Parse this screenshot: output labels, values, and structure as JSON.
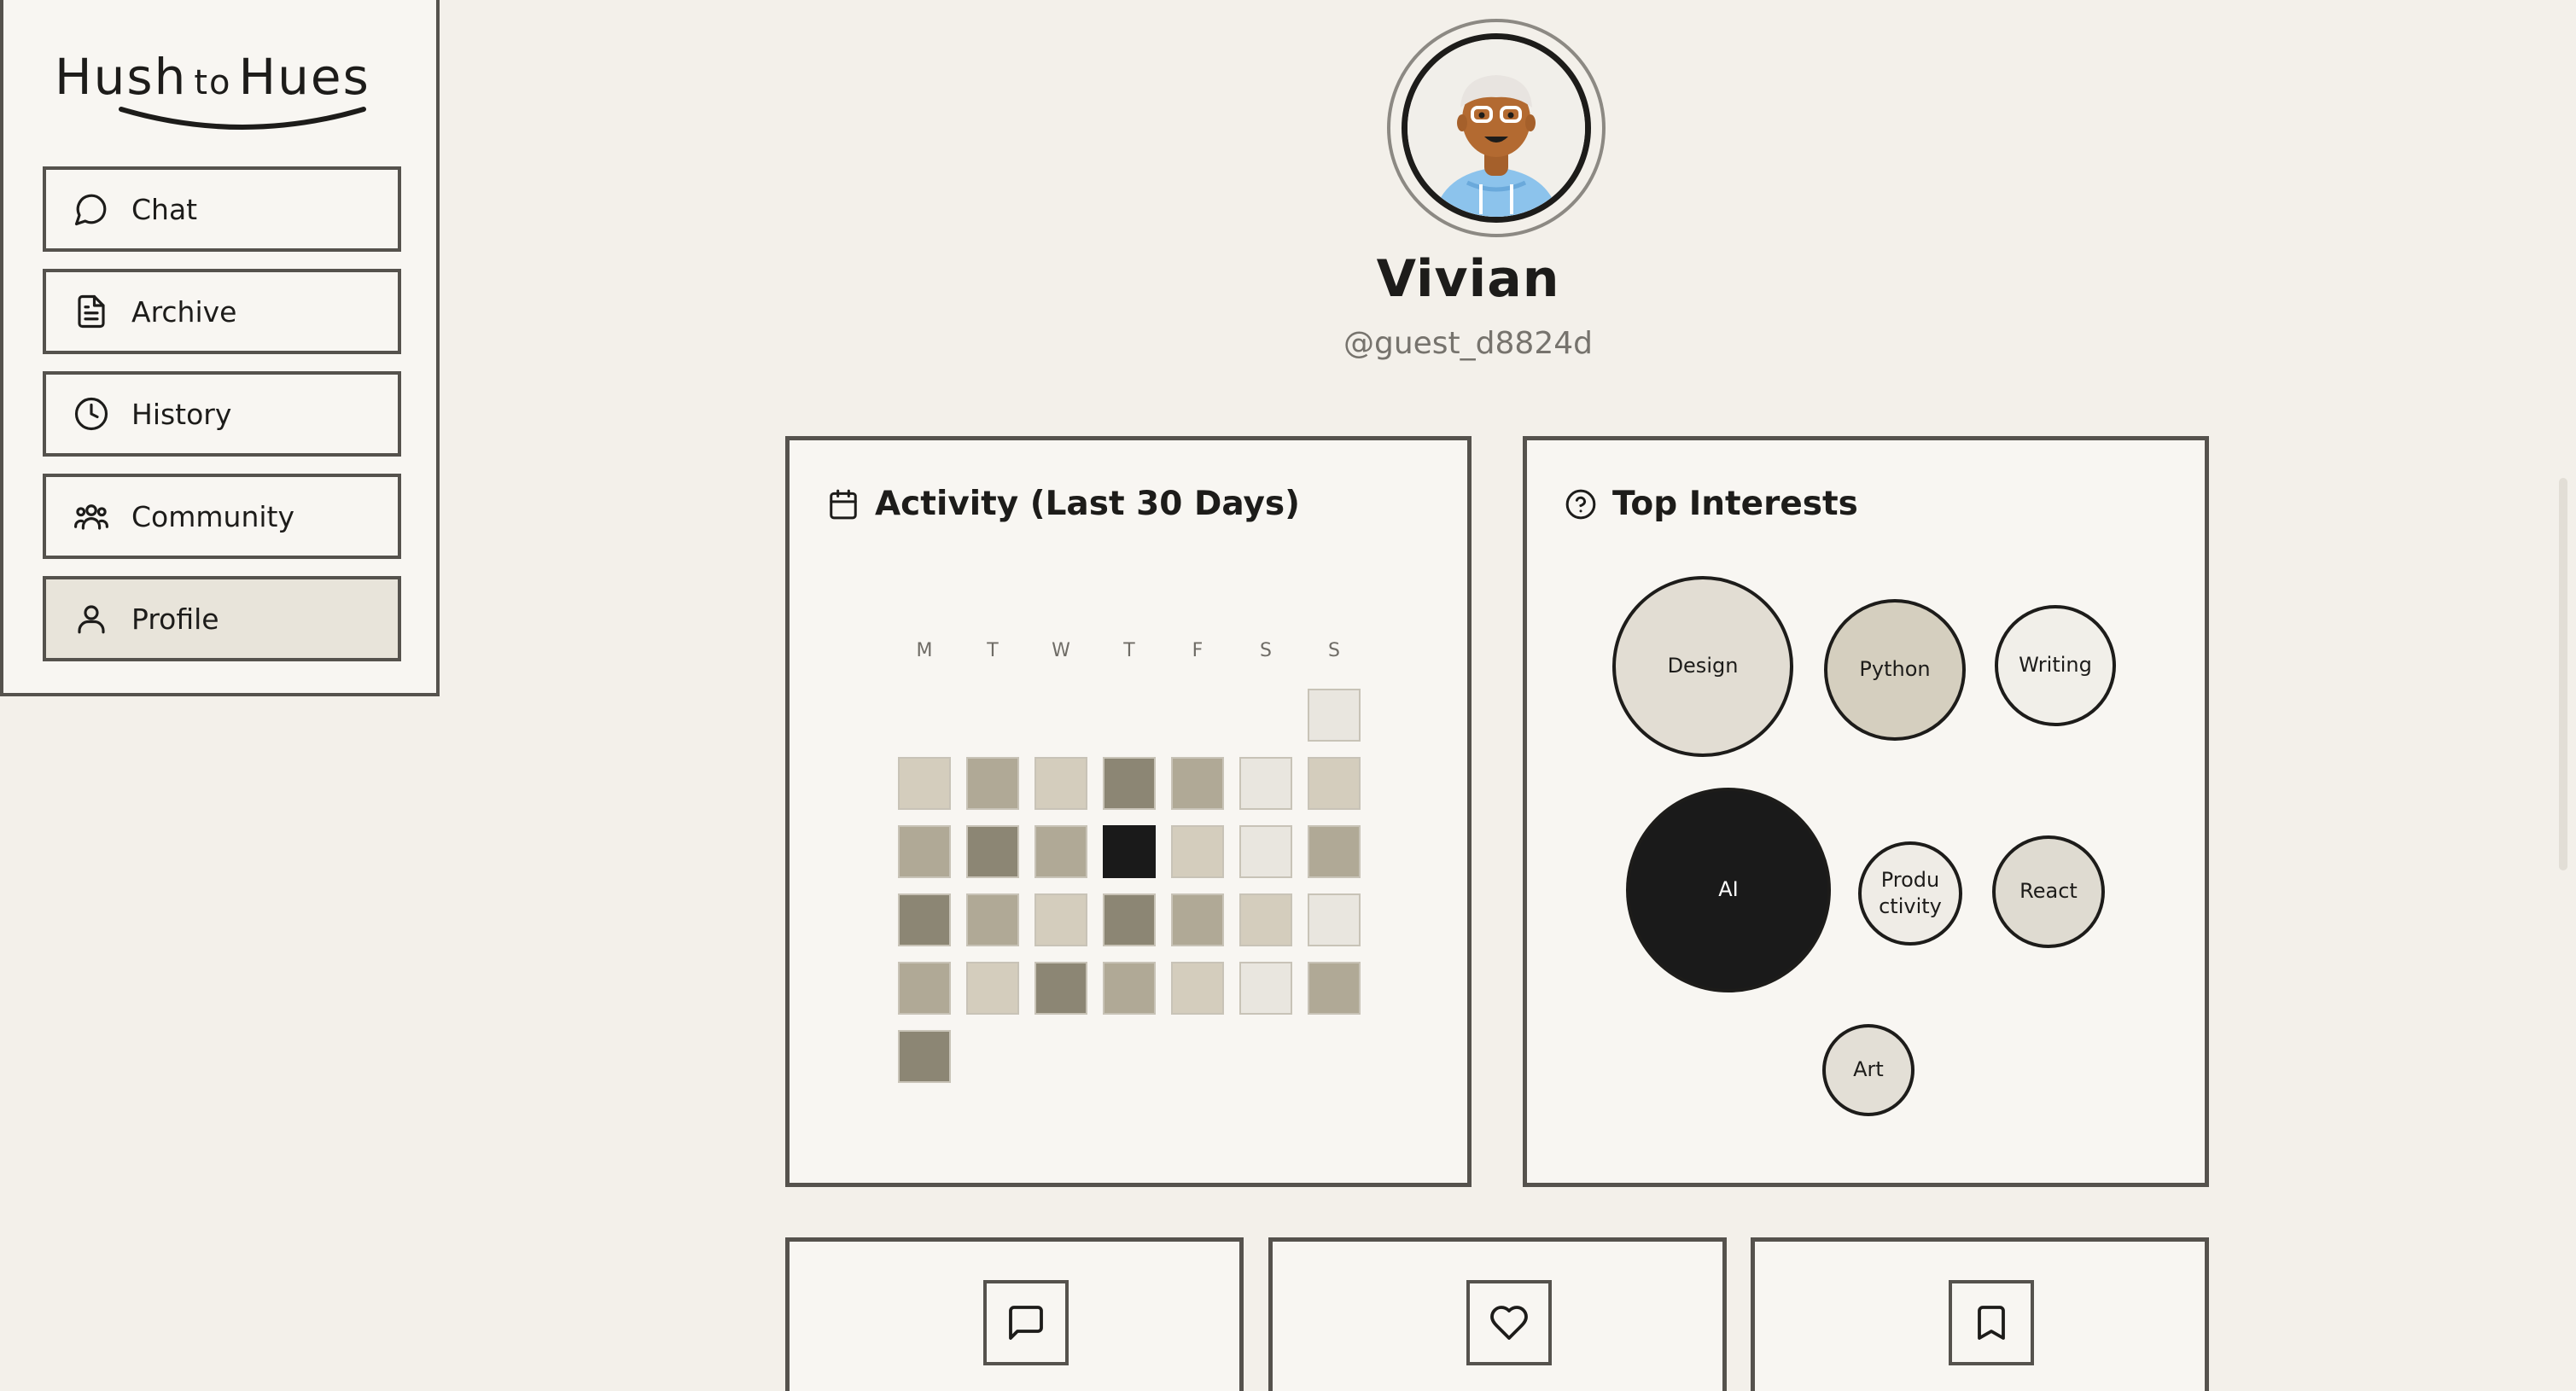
{
  "brand": {
    "part1": "Hush",
    "part2": "to",
    "part3": "Hues"
  },
  "nav": {
    "items": [
      {
        "label": "Chat",
        "icon": "chat-bubble-icon",
        "active": false
      },
      {
        "label": "Archive",
        "icon": "document-icon",
        "active": false
      },
      {
        "label": "History",
        "icon": "clock-icon",
        "active": false
      },
      {
        "label": "Community",
        "icon": "people-icon",
        "active": false
      },
      {
        "label": "Profile",
        "icon": "user-icon",
        "active": true
      }
    ]
  },
  "profile": {
    "name": "Vivian",
    "handle": "@guest_d8824d"
  },
  "activity": {
    "title": "Activity (Last 30 Days)",
    "icon": "calendar-icon",
    "weekdays": [
      "M",
      "T",
      "W",
      "T",
      "F",
      "S",
      "S"
    ],
    "weeks": [
      [
        null,
        null,
        null,
        null,
        null,
        null,
        1
      ],
      [
        2,
        3,
        2,
        4,
        3,
        1,
        2
      ],
      [
        3,
        4,
        3,
        5,
        2,
        1,
        3
      ],
      [
        4,
        3,
        2,
        4,
        3,
        2,
        1
      ],
      [
        3,
        2,
        4,
        3,
        2,
        1,
        3
      ],
      [
        4,
        null,
        null,
        null,
        null,
        null,
        null
      ]
    ],
    "level_colors": [
      "#e9e6df",
      "#d4cdbd",
      "#b0a996",
      "#8c8674",
      "#1a1a1a"
    ]
  },
  "interests": {
    "title": "Top Interests",
    "icon": "question-circle-icon",
    "items": [
      {
        "line1": "Design",
        "line2": "",
        "fill": "#e2ddd3",
        "dark": false
      },
      {
        "line1": "Python",
        "line2": "",
        "fill": "#d5cfbf",
        "dark": false
      },
      {
        "line1": "Writing",
        "line2": "",
        "fill": "#f1efe9",
        "dark": false
      },
      {
        "line1": "AI",
        "line2": "",
        "fill": "#1a1a1a",
        "dark": true
      },
      {
        "line1": "Produ",
        "line2": "ctivity",
        "fill": "#efece6",
        "dark": false
      },
      {
        "line1": "React",
        "line2": "",
        "fill": "#dfdbd1",
        "dark": false
      },
      {
        "line1": "Art",
        "line2": "",
        "fill": "#e3dfd6",
        "dark": false
      }
    ]
  },
  "stats": [
    {
      "icon": "message-square-icon"
    },
    {
      "icon": "heart-icon"
    },
    {
      "icon": "bookmark-icon"
    }
  ]
}
